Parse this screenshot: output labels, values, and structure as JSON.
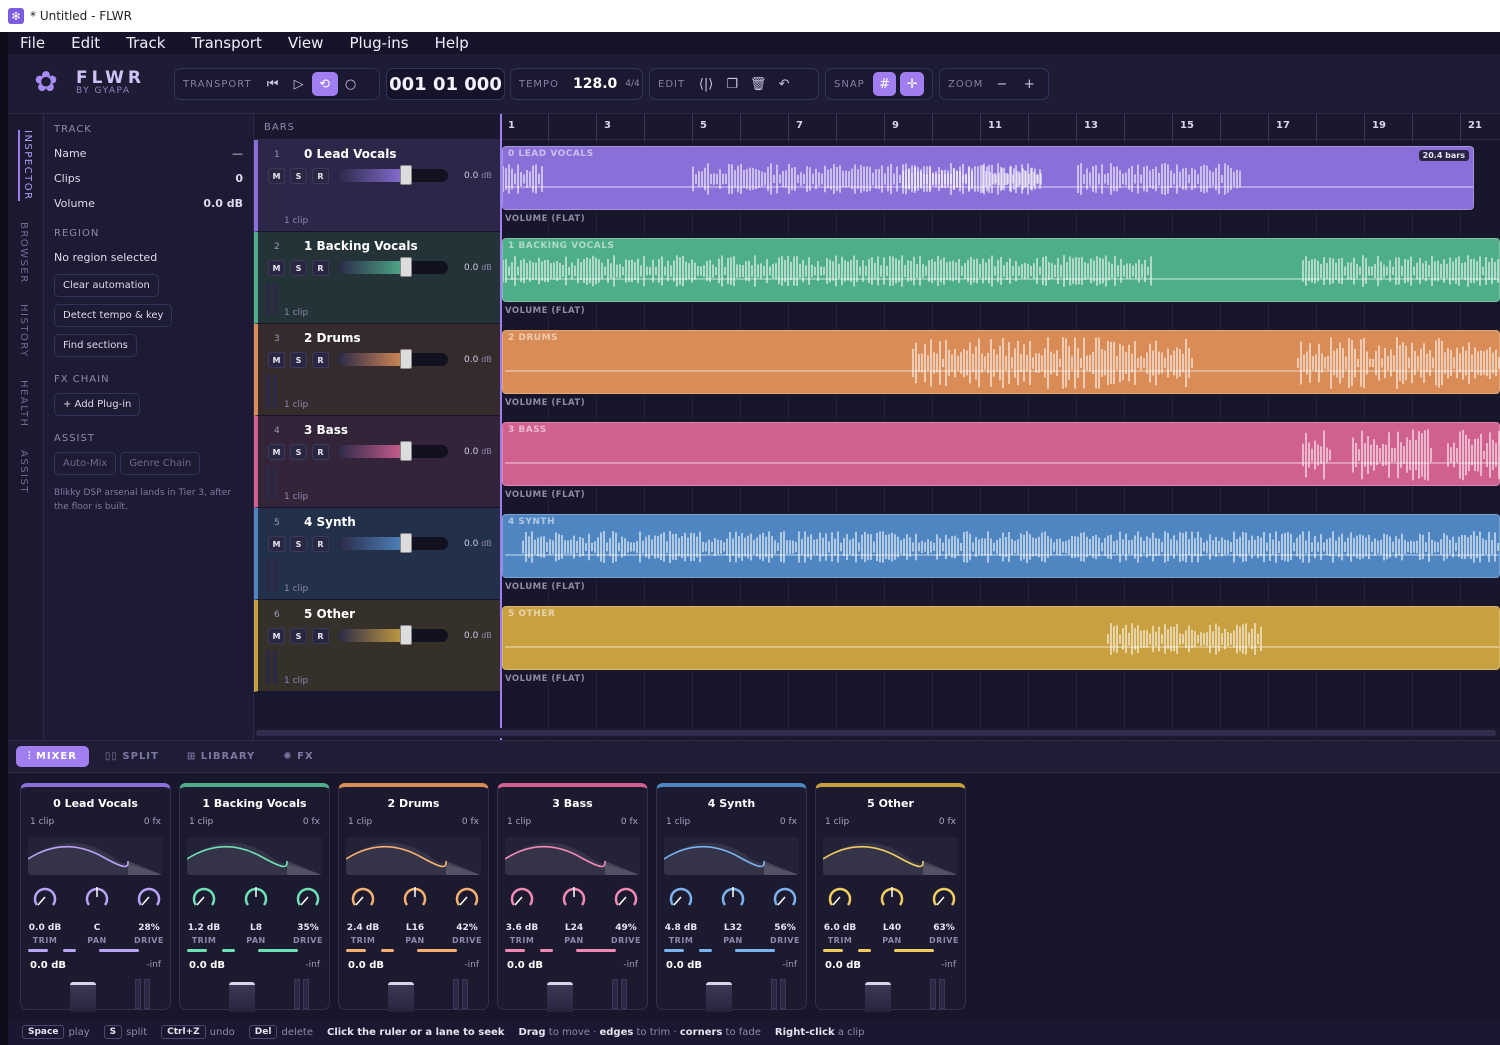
{
  "window": {
    "title": "* Untitled - FLWR"
  },
  "menu": [
    "File",
    "Edit",
    "Track",
    "Transport",
    "View",
    "Plug-ins",
    "Help"
  ],
  "brand": {
    "name": "FLWR",
    "sub": "BY GYAPA"
  },
  "toolbar": {
    "transport_label": "TRANSPORT",
    "timecode": "001 01 000",
    "tempo_label": "TEMPO",
    "tempo": "128.0",
    "time_sig": "4/4",
    "edit_label": "EDIT",
    "snap_label": "SNAP",
    "zoom_label": "ZOOM",
    "zoom_out": "−",
    "zoom_in": "+"
  },
  "sidetabs": [
    "INSPECTOR",
    "BROWSER",
    "HISTORY",
    "HEALTH",
    "ASSIST"
  ],
  "inspector": {
    "track_section": "TRACK",
    "name_label": "Name",
    "name_value": "—",
    "clips_label": "Clips",
    "clips_value": "0",
    "volume_label": "Volume",
    "volume_value": "0.0 dB",
    "region_section": "REGION",
    "region_status": "No region selected",
    "btn_clear": "Clear automation",
    "btn_detect": "Detect tempo & key",
    "btn_find": "Find sections",
    "fx_section": "FX CHAIN",
    "btn_add_plugin": "+ Add Plug-in",
    "assist_section": "ASSIST",
    "btn_automix": "Auto-Mix",
    "btn_genre": "Genre Chain",
    "assist_note": "Blikky DSP arsenal lands in Tier 3, after the floor is built."
  },
  "timeline": {
    "bars_label": "BARS",
    "ruler": [
      "1",
      "3",
      "5",
      "7",
      "9",
      "11",
      "13",
      "15",
      "17",
      "19",
      "21"
    ],
    "clip_badge": "20.4 bars",
    "automation_label": "VOLUME (FLAT)"
  },
  "tracks": [
    {
      "num": "1",
      "name": "0 Lead Vocals",
      "clip_title": "0 LEAD VOCALS",
      "db": "0.0",
      "unit": "dB",
      "clips": "1 clip",
      "color": "#8a6fd8"
    },
    {
      "num": "2",
      "name": "1 Backing Vocals",
      "clip_title": "1 BACKING VOCALS",
      "db": "0.0",
      "unit": "dB",
      "clips": "1 clip",
      "color": "#4fae8a"
    },
    {
      "num": "3",
      "name": "2 Drums",
      "clip_title": "2 DRUMS",
      "db": "0.0",
      "unit": "dB",
      "clips": "1 clip",
      "color": "#d98c55"
    },
    {
      "num": "4",
      "name": "3 Bass",
      "clip_title": "3 BASS",
      "db": "0.0",
      "unit": "dB",
      "clips": "1 clip",
      "color": "#d0608f"
    },
    {
      "num": "5",
      "name": "4 Synth",
      "clip_title": "4 SYNTH",
      "db": "0.0",
      "unit": "dB",
      "clips": "1 clip",
      "color": "#4f86c2"
    },
    {
      "num": "6",
      "name": "5 Other",
      "clip_title": "5 OTHER",
      "db": "0.0",
      "unit": "dB",
      "clips": "1 clip",
      "color": "#c9a040"
    }
  ],
  "msr": [
    "M",
    "S",
    "R"
  ],
  "bottom_tabs": [
    "MIXER",
    "SPLIT",
    "LIBRARY",
    "FX"
  ],
  "mixer": [
    {
      "name": "0 Lead Vocals",
      "clips": "1 clip",
      "fx": "0 fx",
      "trim": "0.0 dB",
      "pan": "C",
      "drive": "28%",
      "vol": "0.0 dB",
      "inf": "-inf",
      "color": "#b9a3f5"
    },
    {
      "name": "1 Backing Vocals",
      "clips": "1 clip",
      "fx": "0 fx",
      "trim": "1.2 dB",
      "pan": "L8",
      "drive": "35%",
      "vol": "0.0 dB",
      "inf": "-inf",
      "color": "#6fe0b5"
    },
    {
      "name": "2 Drums",
      "clips": "1 clip",
      "fx": "0 fx",
      "trim": "2.4 dB",
      "pan": "L16",
      "drive": "42%",
      "vol": "0.0 dB",
      "inf": "-inf",
      "color": "#f5b070"
    },
    {
      "name": "3 Bass",
      "clips": "1 clip",
      "fx": "0 fx",
      "trim": "3.6 dB",
      "pan": "L24",
      "drive": "49%",
      "vol": "0.0 dB",
      "inf": "-inf",
      "color": "#f08ab5"
    },
    {
      "name": "4 Synth",
      "clips": "1 clip",
      "fx": "0 fx",
      "trim": "4.8 dB",
      "pan": "L32",
      "drive": "56%",
      "vol": "0.0 dB",
      "inf": "-inf",
      "color": "#7ab2ee"
    },
    {
      "name": "5 Other",
      "clips": "1 clip",
      "fx": "0 fx",
      "trim": "6.0 dB",
      "pan": "L40",
      "drive": "63%",
      "vol": "0.0 dB",
      "inf": "-inf",
      "color": "#f0cc60"
    }
  ],
  "knob_labels": {
    "trim": "TRIM",
    "pan": "PAN",
    "drive": "DRIVE"
  },
  "status": {
    "k1": "Space",
    "t1": "play",
    "k2": "S",
    "t2": "split",
    "k3": "Ctrl+Z",
    "t3": "undo",
    "k4": "Del",
    "t4": "delete",
    "h1": "Click the ruler or a lane to seek",
    "h2a": "Drag",
    "h2b": "to move ·",
    "h2c": "edges",
    "h2d": "to trim ·",
    "h2e": "corners",
    "h2f": "to fade",
    "h3a": "Right-click",
    "h3b": "a clip"
  }
}
